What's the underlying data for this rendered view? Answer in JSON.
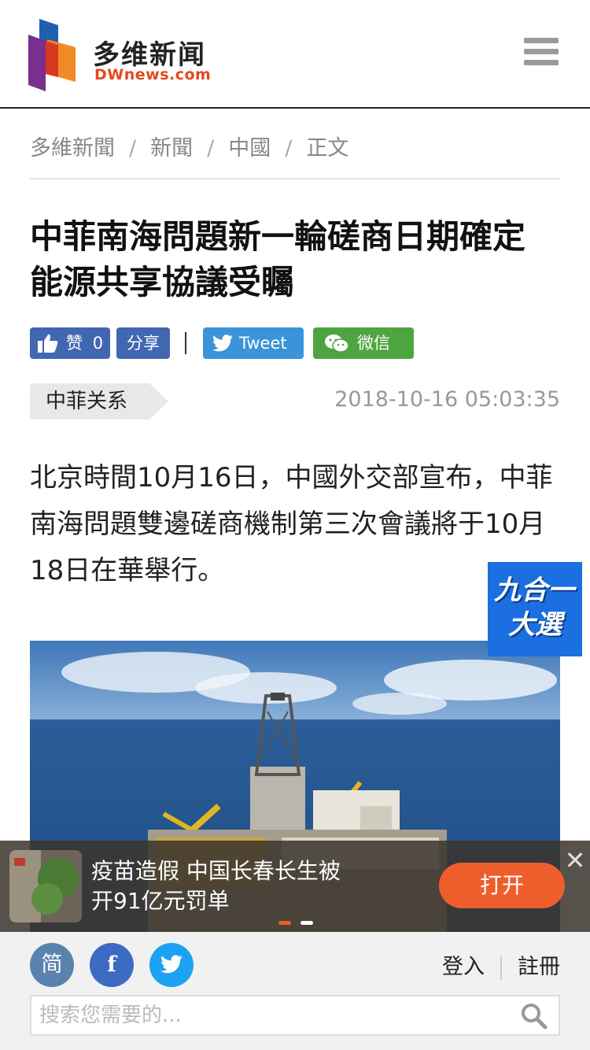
{
  "header": {
    "logo_cn": "多维新闻",
    "logo_en": "DWnews.com",
    "menu_icon": "hamburger-menu-icon"
  },
  "breadcrumb": {
    "items": [
      "多維新聞",
      "新聞",
      "中國",
      "正文"
    ],
    "separator": "/"
  },
  "article": {
    "title": "中菲南海問題新一輪磋商日期確定 能源共享協議受矚",
    "tag": "中菲关系",
    "date": "2018-10-16 05:03:35",
    "lede": "北京時間10月16日，中國外交部宣布，中菲南海問題雙邊磋商機制第三次會議將于10月18日在華舉行。"
  },
  "share": {
    "like_label": "赞",
    "like_count": "0",
    "share_label": "分享",
    "tweet_label": "Tweet",
    "wechat_label": "微信"
  },
  "badge": {
    "text_line1": "九合一",
    "text_line2": "大選"
  },
  "ad": {
    "text": "疫苗造假 中国长春长生被开91亿元罚单",
    "button": "打开",
    "close": "✕"
  },
  "footer": {
    "simplified_label": "简",
    "facebook_label": "f",
    "login": "登入",
    "register": "註冊",
    "search_placeholder": "搜索您需要的..."
  },
  "colors": {
    "brand_orange": "#e14a1c",
    "facebook_blue": "#4267b2",
    "twitter_blue": "#3b94d9",
    "wechat_green": "#4ea53f",
    "ad_button": "#ee5d2c"
  }
}
